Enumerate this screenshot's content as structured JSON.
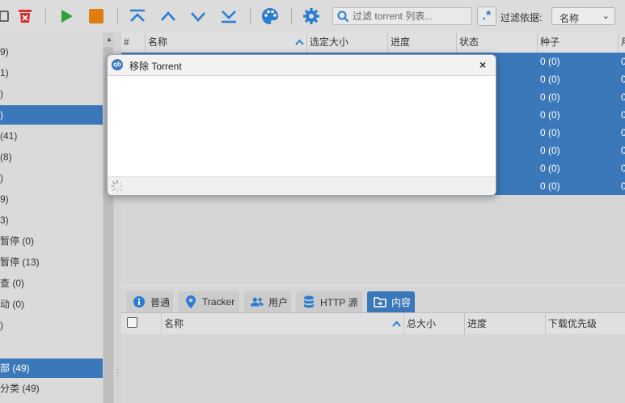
{
  "toolbar": {
    "search_placeholder": "过滤 torrent 列表...",
    "regex_label": ".*",
    "filter_by_label": "过滤依据:",
    "filter_by_value": "名称",
    "filter_by_chevron": "⌄"
  },
  "sidebar": {
    "items": [
      {
        "label": "9)",
        "selected": false
      },
      {
        "label": "1)",
        "selected": false
      },
      {
        "label": ")",
        "selected": false
      },
      {
        "label": ")",
        "selected": true
      },
      {
        "label": " (41)",
        "selected": false
      },
      {
        "label": " (8)",
        "selected": false
      },
      {
        "label": ")",
        "selected": false
      },
      {
        "label": "9)",
        "selected": false
      },
      {
        "label": "3)",
        "selected": false
      },
      {
        "label": "暂停 (0)",
        "selected": false
      },
      {
        "label": "暂停 (13)",
        "selected": false
      },
      {
        "label": "查 (0)",
        "selected": false
      },
      {
        "label": "动 (0)",
        "selected": false
      },
      {
        "label": ")",
        "selected": false
      },
      {
        "label": "",
        "selected": false
      },
      {
        "label": "部 (49)",
        "selected": true
      },
      {
        "label": "分类 (49)",
        "selected": false
      }
    ]
  },
  "table": {
    "headers": [
      "#",
      "名称",
      "选定大小",
      "进度",
      "状态",
      "种子",
      "用"
    ],
    "sort_indicator": "^",
    "rows": [
      {
        "seeds": "0 (0)",
        "extra": "0"
      },
      {
        "seeds": "0 (0)",
        "extra": "0"
      },
      {
        "seeds": "0 (0)",
        "extra": "0"
      },
      {
        "seeds": "0 (0)",
        "extra": "0"
      },
      {
        "seeds": "0 (0)",
        "extra": "0"
      },
      {
        "seeds": "0 (0)",
        "extra": "0"
      },
      {
        "seeds": "0 (0)",
        "extra": "0"
      },
      {
        "seeds": "0 (0)",
        "extra": "0"
      }
    ]
  },
  "properties": {
    "tabs": [
      {
        "label": "普通",
        "icon": "info-icon",
        "selected": false
      },
      {
        "label": "Tracker",
        "icon": "location-pin-icon",
        "selected": false
      },
      {
        "label": "用户",
        "icon": "users-icon",
        "selected": false
      },
      {
        "label": "HTTP 源",
        "icon": "database-icon",
        "selected": false
      },
      {
        "label": "内容",
        "icon": "folder-link-icon",
        "selected": true
      }
    ],
    "content_headers": [
      "名称",
      "总大小",
      "进度",
      "下载优先级"
    ]
  },
  "dialog": {
    "title": "移除 Torrent",
    "icon_text": "qb",
    "close": "×"
  },
  "colors": {
    "selection": "#3b78ba",
    "play": "#2aa43a",
    "stop": "#e07d10",
    "delete": "#d32f2f",
    "accent": "#2b7cd3"
  }
}
